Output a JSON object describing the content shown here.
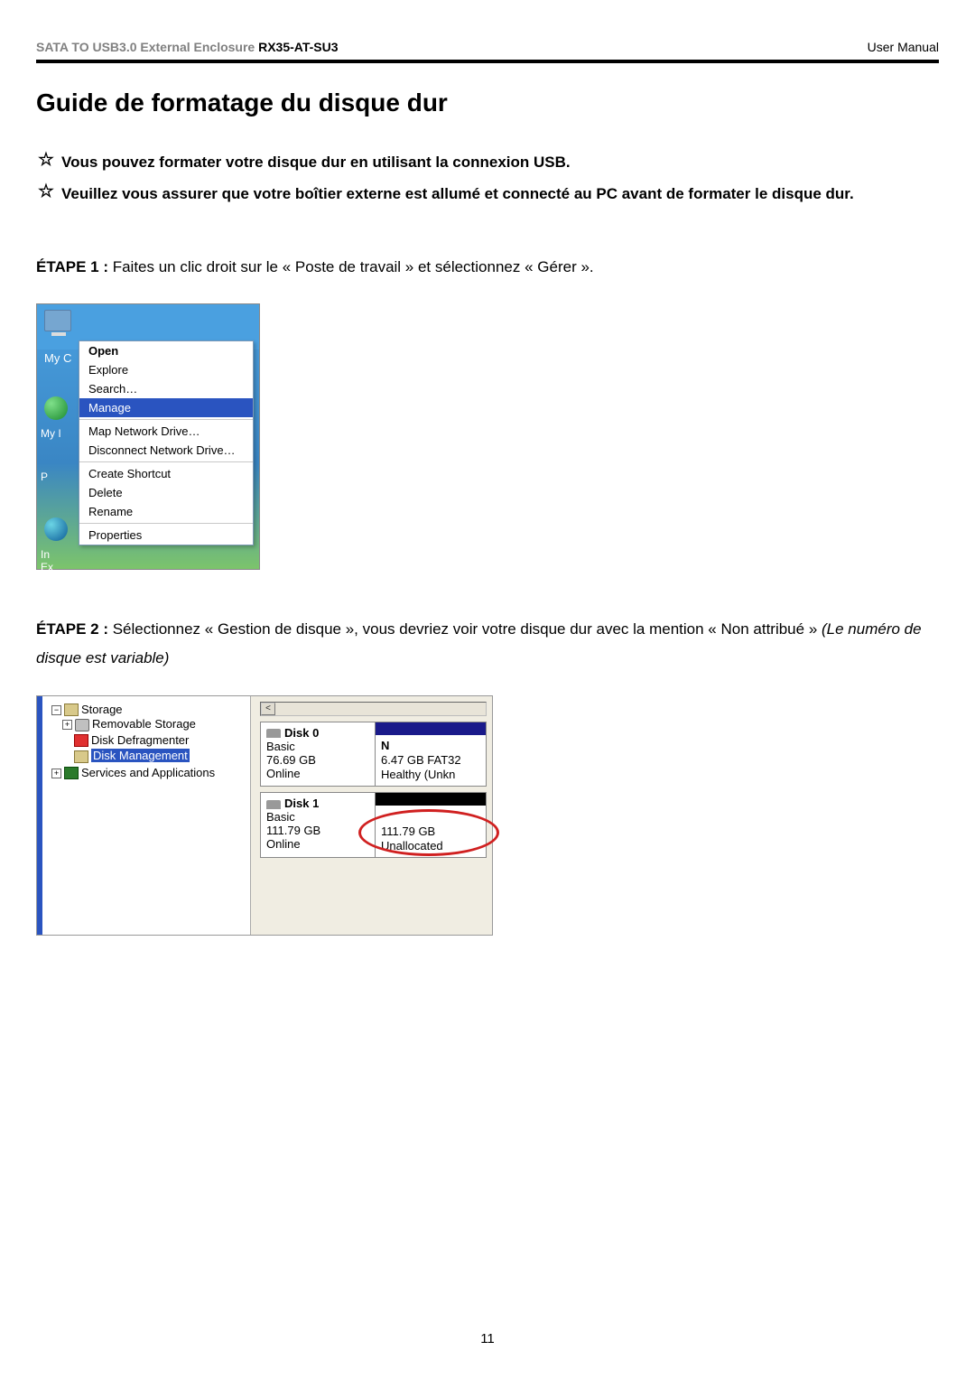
{
  "header": {
    "product_prefix": "SATA TO USB3.0 External Enclosure ",
    "model": "RX35-AT-SU3",
    "right": "User Manual"
  },
  "title": "Guide de formatage du disque dur",
  "notes": {
    "n1": "Vous pouvez formater votre disque dur en utilisant la connexion USB.",
    "n2": "Veuillez vous assurer que votre boîtier externe est allumé et connecté au PC avant de formater le disque dur."
  },
  "step1": {
    "label": "ÉTAPE 1 :",
    "text": " Faites un clic droit sur le « Poste de travail » et sélectionnez « Gérer »."
  },
  "shot1": {
    "desktop_label_mycomp": "My C",
    "desktop_label_mynet": "My I",
    "desktop_label_p": "P",
    "desktop_label_ie": "In",
    "desktop_label_ex": "Ex",
    "menu": {
      "open": "Open",
      "explore": "Explore",
      "search": "Search…",
      "manage": "Manage",
      "map": "Map Network Drive…",
      "disc": "Disconnect Network Drive…",
      "shortcut": "Create Shortcut",
      "delete": "Delete",
      "rename": "Rename",
      "props": "Properties"
    }
  },
  "step2": {
    "label": "ÉTAPE 2 :",
    "text_a": " Sélectionnez « Gestion de disque », vous devriez voir votre disque dur avec la mention « Non attribué » ",
    "text_b": "(Le numéro de disque est variable)"
  },
  "shot2": {
    "tree": {
      "storage": "Storage",
      "removable": "Removable Storage",
      "defrag": "Disk Defragmenter",
      "dm": "Disk Management",
      "services": "Services and Applications"
    },
    "scroll_left": "<",
    "disk0": {
      "title": "Disk 0",
      "type": "Basic",
      "size": "76.69 GB",
      "status": "Online",
      "part_label": "N",
      "part_size": "6.47 GB FAT32",
      "part_status": "Healthy (Unkn"
    },
    "disk1": {
      "title": "Disk 1",
      "type": "Basic",
      "size": "111.79 GB",
      "status": "Online",
      "part_size": "111.79 GB",
      "part_status": "Unallocated"
    }
  },
  "page_number": "11"
}
